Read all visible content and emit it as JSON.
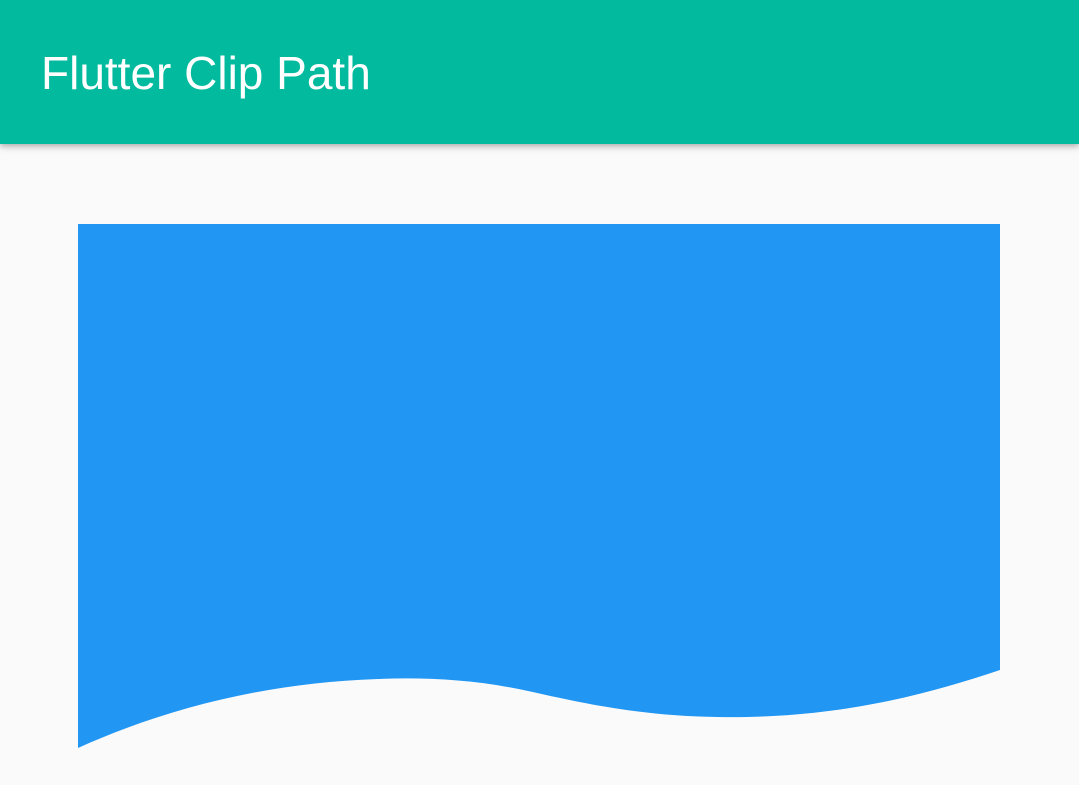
{
  "app_bar": {
    "title": "Flutter Clip Path"
  },
  "colors": {
    "app_bar_background": "#02bb9f",
    "title_text": "#ffffff",
    "page_background": "#fafafa",
    "clipped_container": "#2196f3"
  }
}
